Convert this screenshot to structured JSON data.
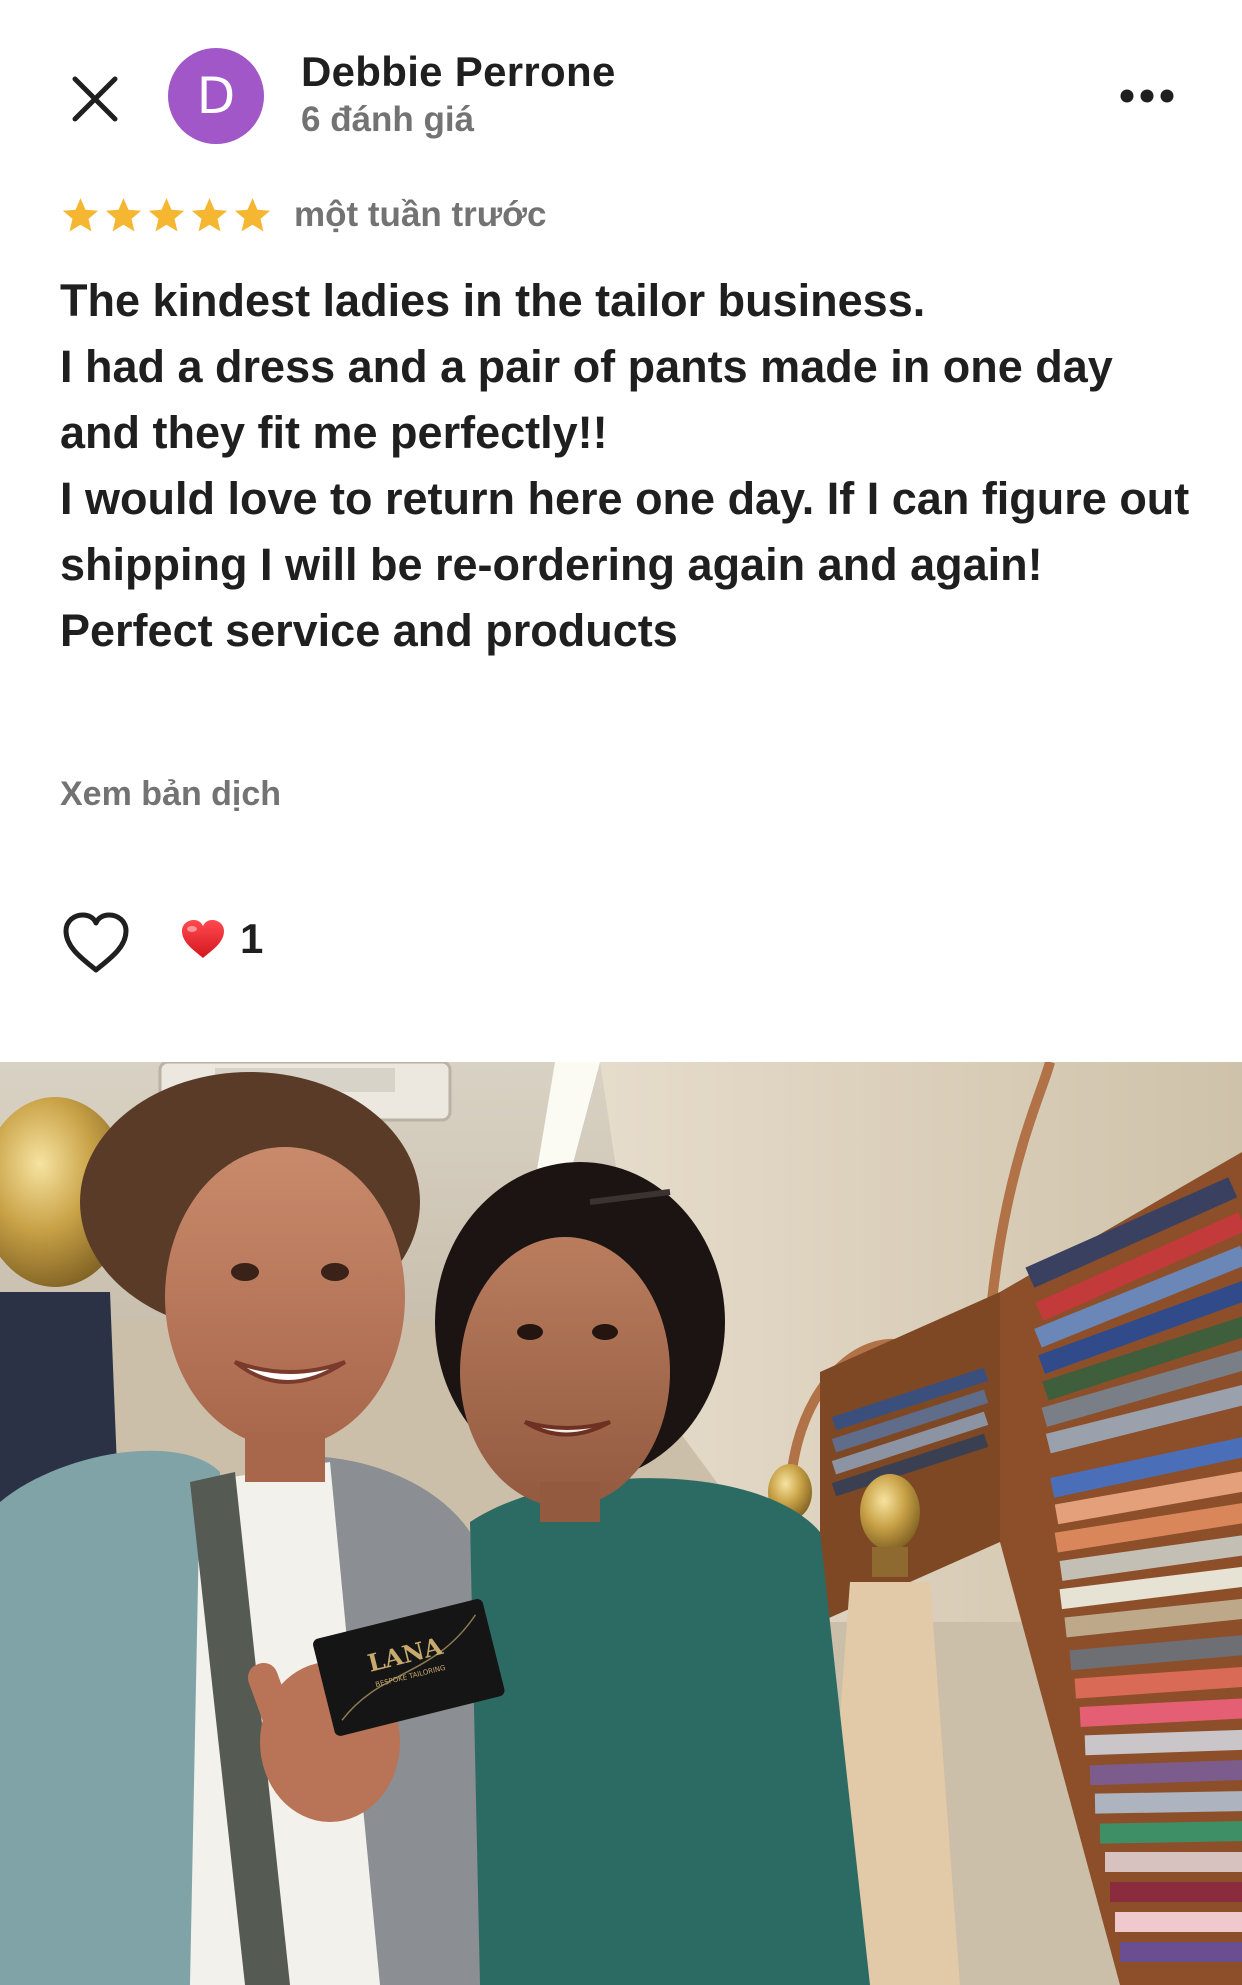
{
  "header": {
    "avatar_letter": "D",
    "author_name": "Debbie Perrone",
    "author_meta": "6 đánh giá",
    "close_icon": "close-icon",
    "more_icon": "more-horizontal-icon"
  },
  "rating": {
    "stars": 5,
    "max_stars": 5,
    "timestamp": "một tuần trước",
    "star_color": "#f5b731"
  },
  "review": {
    "text": "The kindest ladies in the tailor business.\nI had a dress and a pair of pants made in one day and they fit me perfectly!!\nI would love to return here one day. If I can figure out shipping I will be re-ordering again and again!\nPerfect service and products",
    "translate_label": "Xem bản dịch"
  },
  "reactions": {
    "like_icon": "heart-outline-icon",
    "summary_icon": "red-heart-icon",
    "count": "1"
  },
  "photo": {
    "card_brand": "LANA",
    "card_tagline": "BESPOKE TAILORING"
  },
  "colors": {
    "avatar": "#a157c8",
    "secondary_text": "#737373",
    "primary_text": "#1f1f1f",
    "heart_red": "#e0262d"
  }
}
